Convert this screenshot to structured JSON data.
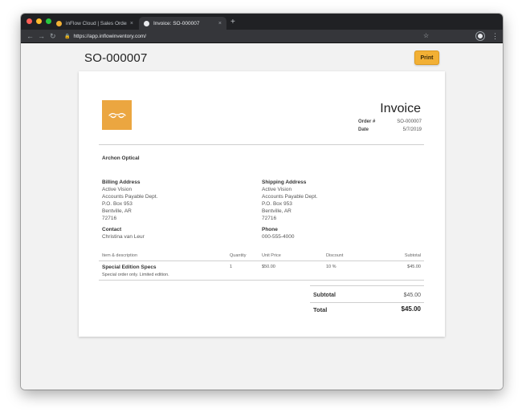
{
  "browser": {
    "tabs": [
      {
        "label": "inFlow Cloud | Sales Orders",
        "active": false
      },
      {
        "label": "Invoice: SO-000007",
        "active": true
      }
    ],
    "new_tab": "+",
    "close_glyph": "×",
    "url": "https://app.inflowinventory.com/",
    "icons": {
      "back": "arrow-left-icon",
      "forward": "arrow-right-icon",
      "reload": "reload-icon",
      "lock": "lock-icon",
      "star": "star-icon",
      "menu": "kebab-menu-icon"
    }
  },
  "page": {
    "title": "SO-000007",
    "print_label": "Print",
    "print_color": "#f2b035"
  },
  "invoice": {
    "heading": "Invoice",
    "order_label": "Order #",
    "order_value": "SO-000007",
    "date_label": "Date",
    "date_value": "5/7/2019",
    "logo_color": "#eba640",
    "company": "Archon Optical",
    "billing": {
      "heading": "Billing Address",
      "lines": [
        "Active Vision",
        "Accounts Payable Dept.",
        "P.O. Box 953",
        "Bentville, AR",
        "72716"
      ]
    },
    "shipping": {
      "heading": "Shipping Address",
      "lines": [
        "Active Vision",
        "Accounts Payable Dept.",
        "P.O. Box 953",
        "Bentville, AR",
        "72716"
      ]
    },
    "contact": {
      "heading": "Contact",
      "value": "Christina van Leur"
    },
    "phone": {
      "heading": "Phone",
      "value": "000-555-4000"
    },
    "table": {
      "headers": [
        "Item & description",
        "Quantity",
        "Unit Price",
        "Discount",
        "Subtotal"
      ],
      "rows": [
        {
          "name": "Special Edition Specs",
          "description": "Special order only. Limited edition.",
          "quantity": "1",
          "unit_price": "$50.00",
          "discount": "10 %",
          "subtotal": "$45.00"
        }
      ]
    },
    "totals": {
      "subtotal_label": "Subtotal",
      "subtotal_value": "$45.00",
      "total_label": "Total",
      "total_value": "$45.00"
    }
  }
}
